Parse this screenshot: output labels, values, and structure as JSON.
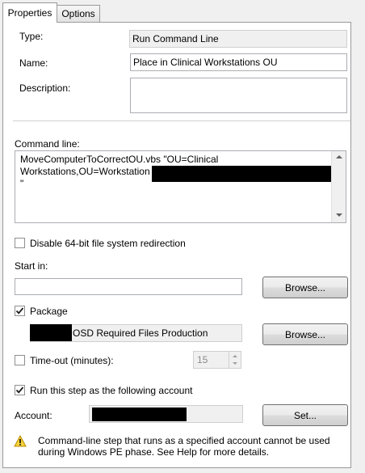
{
  "tabs": [
    {
      "label": "Properties"
    },
    {
      "label": "Options"
    }
  ],
  "type": {
    "label": "Type:",
    "value": "Run Command Line"
  },
  "name": {
    "label": "Name:",
    "value": "Place in Clinical Workstations OU"
  },
  "description": {
    "label": "Description:",
    "value": ""
  },
  "command_line": {
    "label": "Command line:",
    "line1": "MoveComputerToCorrectOU.vbs \"OU=Clinical",
    "line2": "Workstations,OU=Workstation",
    "line3": "\""
  },
  "disable_redirection": {
    "label": "Disable 64-bit file system redirection",
    "checked": false
  },
  "start_in": {
    "label": "Start in:",
    "value": "",
    "browse_label": "Browse..."
  },
  "package": {
    "label": "Package",
    "checked": true,
    "value": "OSD Required Files Production",
    "browse_label": "Browse..."
  },
  "timeout": {
    "label": "Time-out (minutes):",
    "checked": false,
    "value": "15"
  },
  "run_as": {
    "label": "Run this step as the following account",
    "checked": true
  },
  "account": {
    "label": "Account:",
    "set_label": "Set..."
  },
  "warning": {
    "line1": "Command-line step that runs as a specified account cannot be used",
    "line2": "during Windows PE phase. See Help for more details."
  },
  "icons": {
    "warning": "warning-icon",
    "check": "checkmark-icon"
  }
}
